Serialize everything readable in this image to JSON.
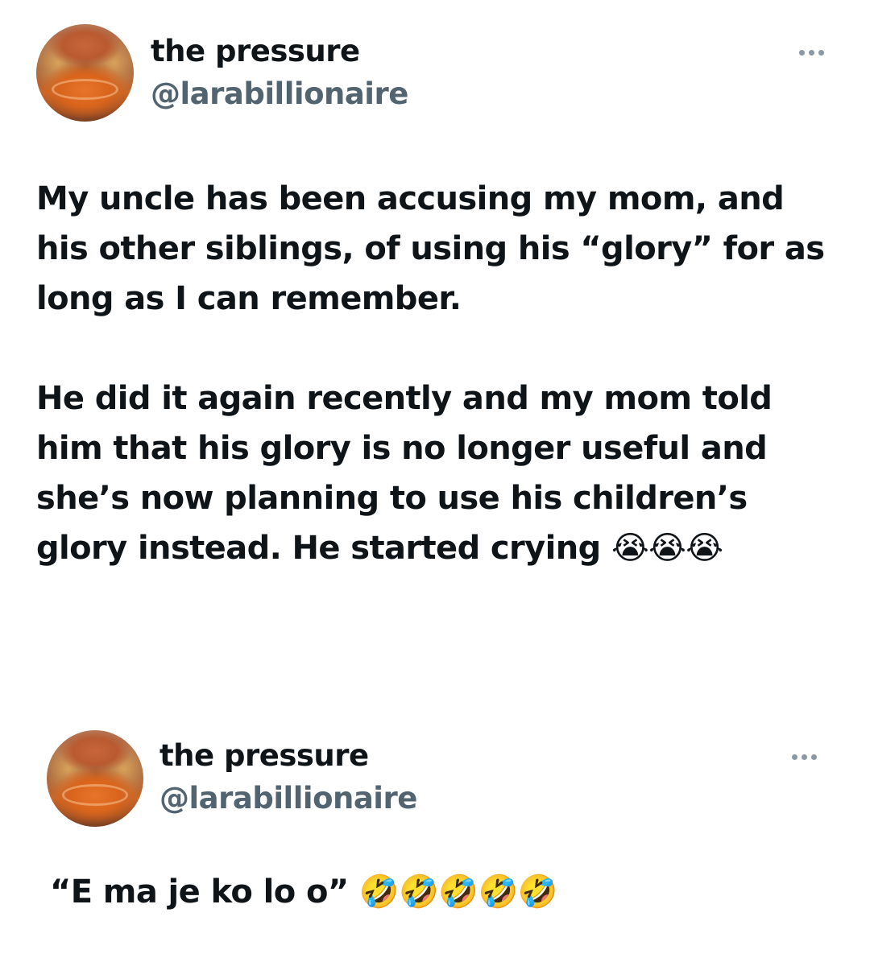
{
  "tweets": [
    {
      "author": {
        "display_name": "the pressure",
        "handle": "@larabillionaire",
        "avatar_icon": "avatar-photo"
      },
      "more_icon": "more-options-icon",
      "text": "My uncle has been accusing my mom, and his other siblings, of using his “glory” for as long as I can remember.\n\nHe did it again recently and my mom told him that his glory is no longer useful and she’s now planning to use his children’s glory instead. He started crying 😭😭😭"
    },
    {
      "author": {
        "display_name": "the pressure",
        "handle": "@larabillionaire",
        "avatar_icon": "avatar-photo"
      },
      "more_icon": "more-options-icon",
      "text": "“E ma je ko lo o” 🤣🤣🤣🤣🤣"
    }
  ],
  "colors": {
    "text_primary": "#0f1419",
    "text_secondary": "#536471",
    "background": "#ffffff"
  }
}
